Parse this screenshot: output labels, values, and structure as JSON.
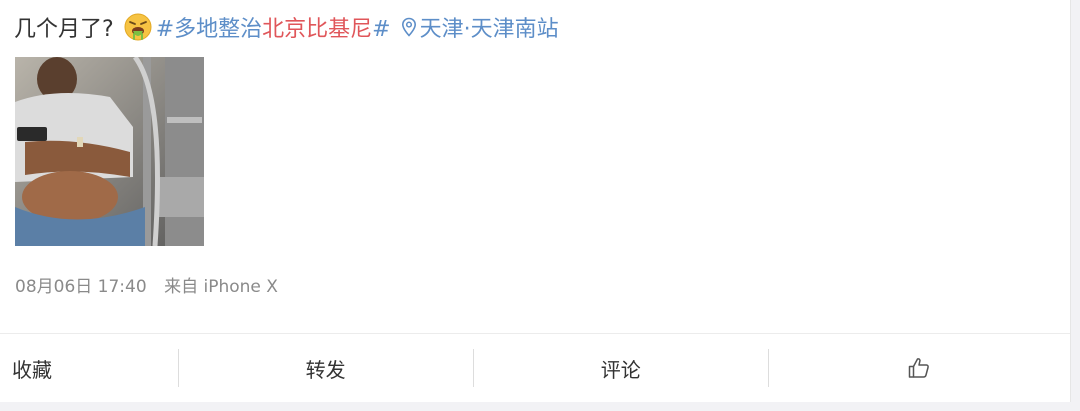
{
  "post": {
    "text": "几个月了?",
    "emoji": "vomiting-face-emoji",
    "hashtag_part1": "#多地整治",
    "hashtag_part2": "北京比基尼",
    "hashtag_part3": "#",
    "location": "天津·天津南站"
  },
  "image": {
    "description_name": "post-photo"
  },
  "meta": {
    "time": "08月06日 17:40",
    "source": "来自 iPhone X"
  },
  "actions": {
    "favorite": "收藏",
    "repost": "转发",
    "comment": "评论",
    "like_icon": "thumbs-up-icon"
  },
  "colors": {
    "link": "#5d8ec8",
    "highlight": "#e0565a",
    "text": "#333333",
    "meta": "#8a8a8a"
  }
}
